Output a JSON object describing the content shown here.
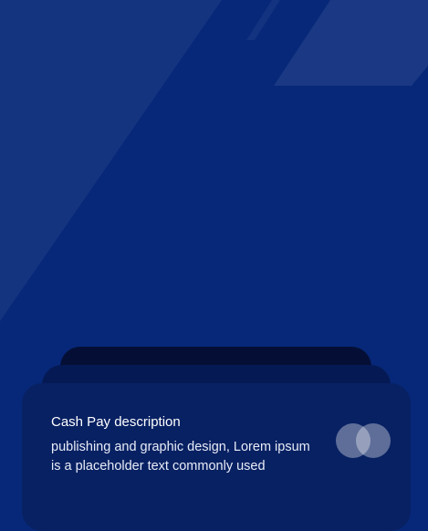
{
  "card": {
    "title": "Cash Pay description",
    "description": "publishing and graphic design, Lorem ipsum is a placeholder text commonly used",
    "logo_icon": "overlapping-circles-icon"
  },
  "colors": {
    "background": "#072879",
    "card_front": "#082163",
    "card_back_1": "#051a54",
    "card_back_2": "#050f35",
    "text": "#ffffff"
  }
}
